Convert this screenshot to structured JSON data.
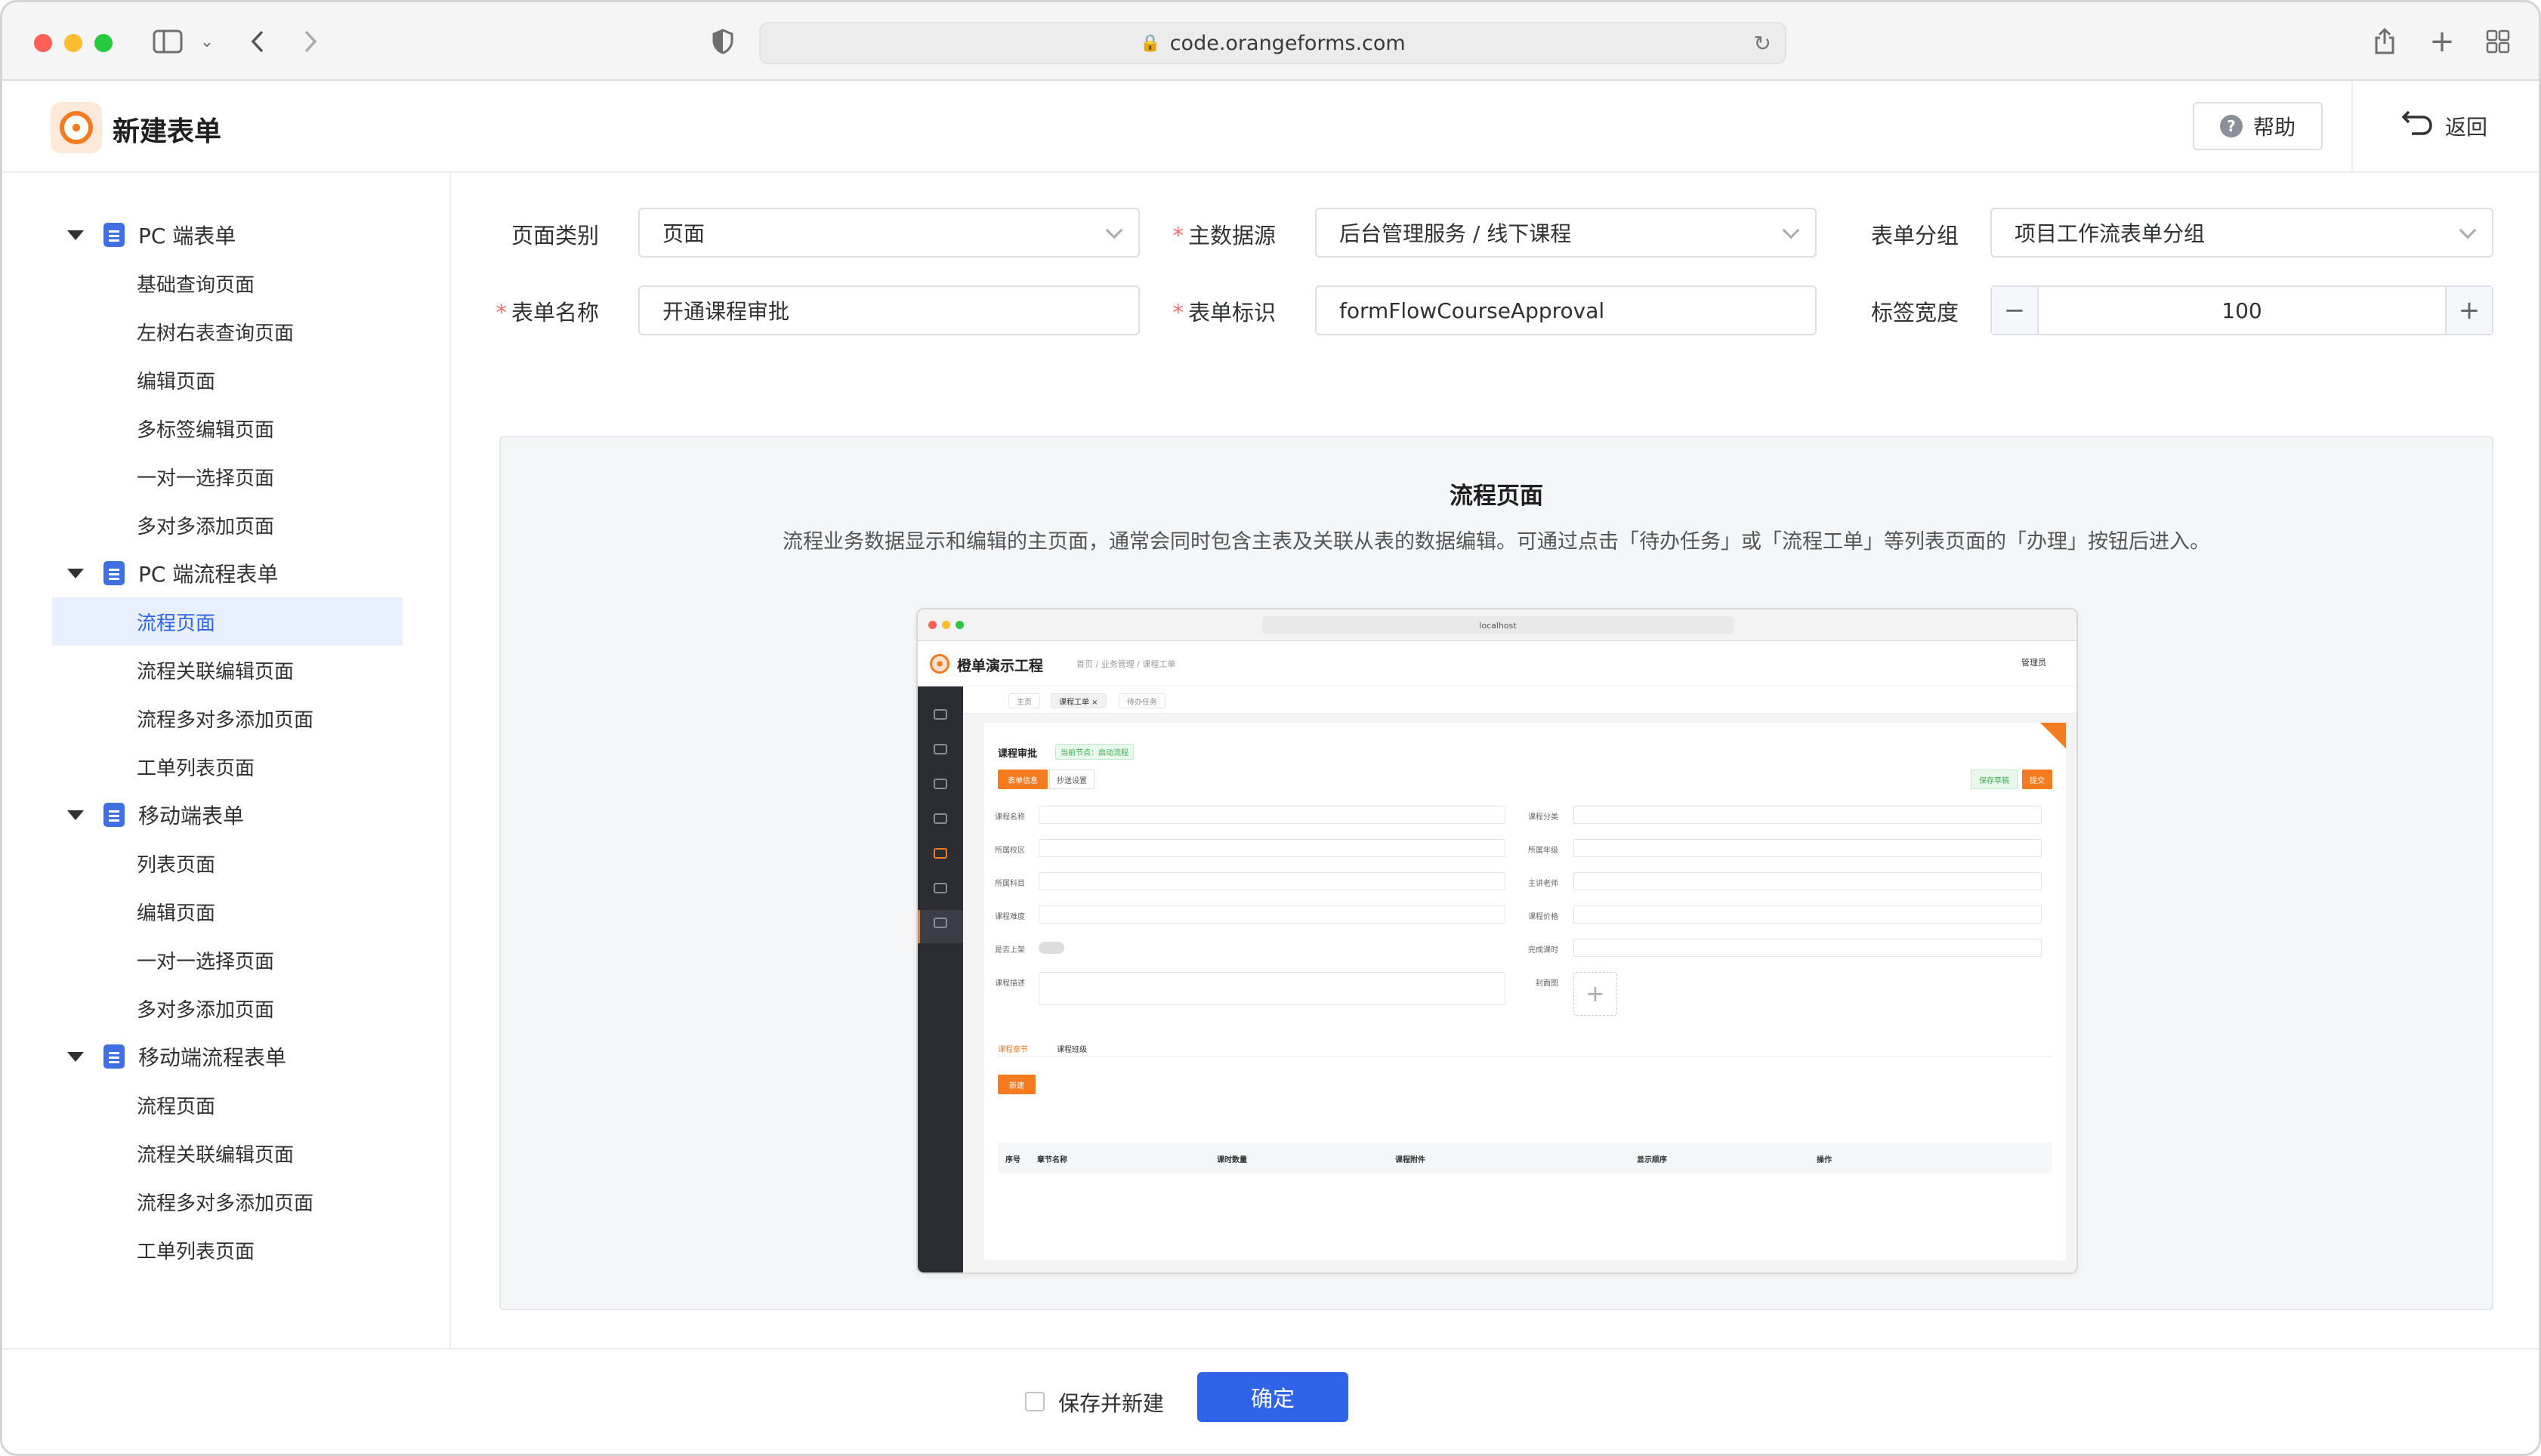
{
  "browser": {
    "url": "code.orangeforms.com"
  },
  "header": {
    "title": "新建表单",
    "help_label": "帮助",
    "back_label": "返回"
  },
  "sidebar": {
    "groups": [
      {
        "label": "PC 端表单",
        "items": [
          "基础查询页面",
          "左树右表查询页面",
          "编辑页面",
          "多标签编辑页面",
          "一对一选择页面",
          "多对多添加页面"
        ]
      },
      {
        "label": "PC 端流程表单",
        "items": [
          "流程页面",
          "流程关联编辑页面",
          "流程多对多添加页面",
          "工单列表页面"
        ]
      },
      {
        "label": "移动端表单",
        "items": [
          "列表页面",
          "编辑页面",
          "一对一选择页面",
          "多对多添加页面"
        ]
      },
      {
        "label": "移动端流程表单",
        "items": [
          "流程页面",
          "流程关联编辑页面",
          "流程多对多添加页面",
          "工单列表页面"
        ]
      }
    ],
    "active": "流程页面"
  },
  "form": {
    "page_type_label": "页面类别",
    "page_type_value": "页面",
    "main_source_label": "主数据源",
    "main_source_value": "后台管理服务 / 线下课程",
    "group_label": "表单分组",
    "group_value": "项目工作流表单分组",
    "name_label": "表单名称",
    "name_value": "开通课程审批",
    "id_label": "表单标识",
    "id_value": "formFlowCourseApproval",
    "label_width_label": "标签宽度",
    "label_width_value": "100",
    "minus": "−",
    "plus": "+"
  },
  "preview": {
    "title": "流程页面",
    "description": "流程业务数据显示和编辑的主页面，通常会同时包含主表及关联从表的数据编辑。可通过点击「待办任务」或「流程工单」等列表页面的「办理」按钮后进入。",
    "mini": {
      "url": "localhost",
      "app_title": "橙单演示工程",
      "breadcrumb": "首页 / 业务管理 / 课程工单",
      "user": "管理员",
      "tabs": [
        "主页",
        "课程工单 ×",
        "待办任务"
      ],
      "panel_title": "课程审批",
      "panel_tag": "当前节点：启动流程",
      "tab_form": "表单信息",
      "tab_cc": "抄送设置",
      "btn_draft": "保存草稿",
      "btn_submit": "提交",
      "fields_left": [
        "课程名称",
        "所属校区",
        "所属科目",
        "课程难度",
        "是否上架",
        "课程描述"
      ],
      "fields_right": [
        "课程分类",
        "所属年级",
        "主讲老师",
        "课程价格",
        "完成课时",
        "封面图"
      ],
      "subtab_1": "课程章节",
      "subtab_2": "课程班级",
      "btn_new": "新建",
      "table_headers": [
        "序号",
        "章节名称",
        "课时数量",
        "课程附件",
        "显示顺序",
        "操作"
      ]
    }
  },
  "footer": {
    "save_new_label": "保存并新建",
    "confirm_label": "确定"
  }
}
